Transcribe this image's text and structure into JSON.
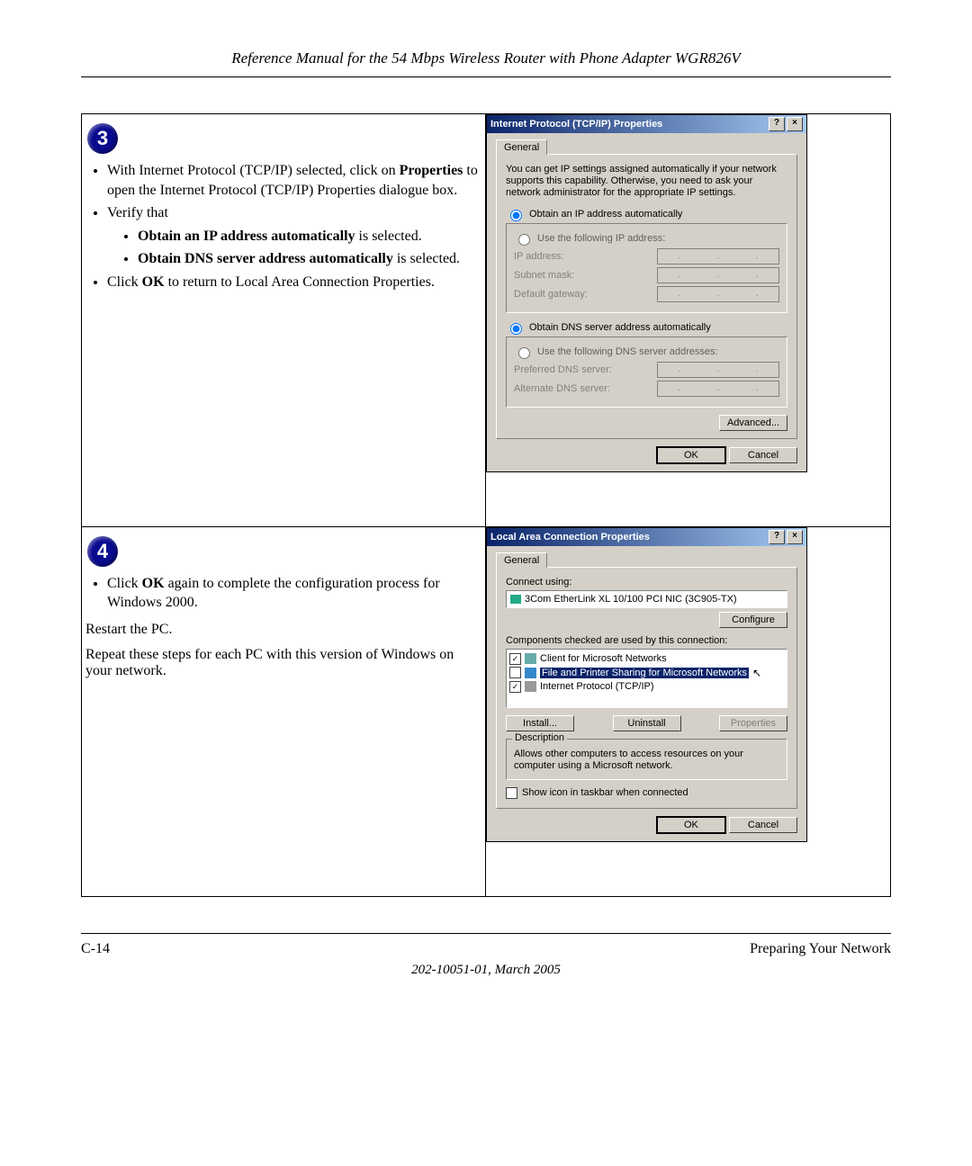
{
  "header_title": "Reference Manual for the 54 Mbps Wireless Router with Phone Adapter WGR826V",
  "footer": {
    "page": "C-14",
    "section": "Preparing Your Network",
    "pubid": "202-10051-01, March 2005"
  },
  "step3": {
    "num": "3",
    "b1_a_pre": "With Internet Protocol (TCP/IP) selected, click on ",
    "b1_a_bold": "Properties",
    "b1_a_post": " to open the Internet Protocol (TCP/IP) Properties dialogue box.",
    "b1_b": "Verify that",
    "b2_a_bold": "Obtain an IP address automatically",
    "b2_a_post": " is selected.",
    "b2_b_bold": "Obtain DNS server address automatically",
    "b2_b_post": " is selected.",
    "b1_c_pre": "Click ",
    "b1_c_bold": "OK",
    "b1_c_post": " to return to Local Area Connection Properties."
  },
  "step4": {
    "num": "4",
    "b1_a_pre": "Click ",
    "b1_a_bold": "OK",
    "b1_a_post": " again to complete the configuration process for Windows 2000.",
    "p1": "Restart the PC.",
    "p2": "Repeat these steps for each PC with this version of Windows on your network."
  },
  "tcpip": {
    "title": "Internet Protocol (TCP/IP) Properties",
    "tab": "General",
    "desc": "You can get IP settings assigned automatically if your network supports this capability. Otherwise, you need to ask your network administrator for the appropriate IP settings.",
    "r_auto_ip": "Obtain an IP address automatically",
    "r_man_ip": "Use the following IP address:",
    "lbl_ip": "IP address:",
    "lbl_mask": "Subnet mask:",
    "lbl_gw": "Default gateway:",
    "r_auto_dns": "Obtain DNS server address automatically",
    "r_man_dns": "Use the following DNS server addresses:",
    "lbl_pdns": "Preferred DNS server:",
    "lbl_adns": "Alternate DNS server:",
    "btn_adv": "Advanced...",
    "btn_ok": "OK",
    "btn_cancel": "Cancel"
  },
  "lac": {
    "title": "Local Area Connection Properties",
    "tab": "General",
    "connect_using": "Connect using:",
    "nic": "3Com EtherLink XL 10/100 PCI NIC (3C905-TX)",
    "btn_configure": "Configure",
    "comp_lbl": "Components checked are used by this connection:",
    "c1": "Client for Microsoft Networks",
    "c2": "File and Printer Sharing for Microsoft Networks",
    "c3": "Internet Protocol (TCP/IP)",
    "btn_install": "Install...",
    "btn_uninstall": "Uninstall",
    "btn_properties": "Properties",
    "desc_legend": "Description",
    "desc_text": "Allows other computers to access resources on your computer using a Microsoft network.",
    "show_icon": "Show icon in taskbar when connected",
    "btn_ok": "OK",
    "btn_cancel": "Cancel"
  }
}
